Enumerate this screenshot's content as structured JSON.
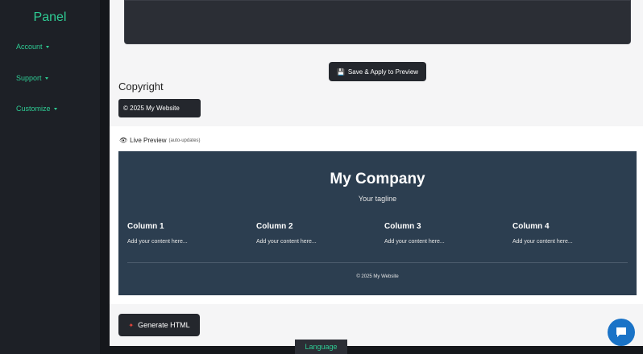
{
  "sidebar": {
    "brand": "Panel",
    "items": [
      {
        "label": "Account"
      },
      {
        "label": "Support"
      },
      {
        "label": "Customize"
      }
    ]
  },
  "editor": {
    "save_button_label": "Save & Apply to Preview",
    "copyright_label": "Copyright",
    "copyright_value": "© 2025 My Website"
  },
  "preview": {
    "title": "Live Preview",
    "subtitle": "(auto-updates)",
    "company": "My Company",
    "tagline": "Your tagline",
    "columns": [
      {
        "heading": "Column 1",
        "text": "Add your content here..."
      },
      {
        "heading": "Column 2",
        "text": "Add your content here..."
      },
      {
        "heading": "Column 3",
        "text": "Add your content here..."
      },
      {
        "heading": "Column 4",
        "text": "Add your content here..."
      }
    ],
    "footer": "© 2025 My Website"
  },
  "actions": {
    "generate_label": "Generate HTML"
  },
  "footer_bar": {
    "language_label": "Language"
  },
  "colors": {
    "accent": "#2ecc94",
    "preview_bg": "#2c3e50",
    "chat": "#1a73c7"
  }
}
